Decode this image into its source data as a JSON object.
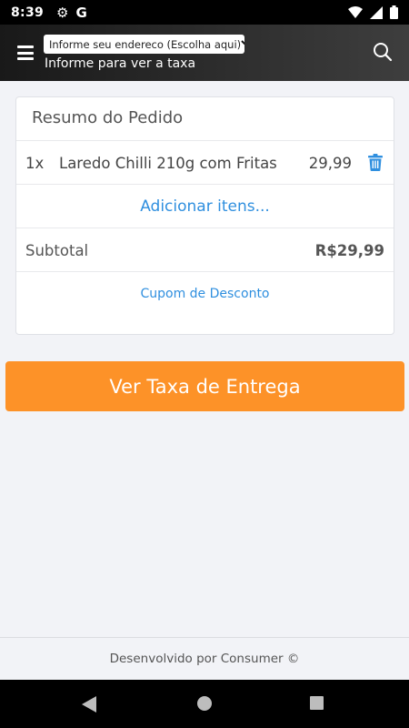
{
  "status_bar": {
    "time": "8:39",
    "left_icons": [
      "gear-icon",
      "google-icon"
    ],
    "google_glyph": "G",
    "right_icons": [
      "wifi-icon",
      "signal-icon",
      "battery-icon"
    ]
  },
  "header": {
    "address_select": "Informe seu endereco (Escolha aqui)",
    "fee_hint": "Informe para ver a taxa",
    "menu_icon": "hamburger-icon",
    "search_icon": "search-icon"
  },
  "order": {
    "title": "Resumo do Pedido",
    "items": [
      {
        "qty": "1x",
        "name": "Laredo Chilli 210g com Fritas",
        "price": "29,99",
        "delete_icon": "trash-icon"
      }
    ],
    "add_items_label": "Adicionar itens...",
    "subtotal_label": "Subtotal",
    "subtotal_value": "R$29,99",
    "coupon_label": "Cupom de Desconto"
  },
  "cta": {
    "label": "Ver Taxa de Entrega"
  },
  "footer": {
    "text": "Desenvolvido por Consumer ©"
  },
  "nav_bar": {
    "icons": [
      "back-icon",
      "home-icon",
      "recents-icon"
    ]
  },
  "colors": {
    "accent_orange": "#fd9228",
    "link_blue": "#2f8fdf",
    "background": "#f2f3f7",
    "header_dark": "#191919"
  }
}
